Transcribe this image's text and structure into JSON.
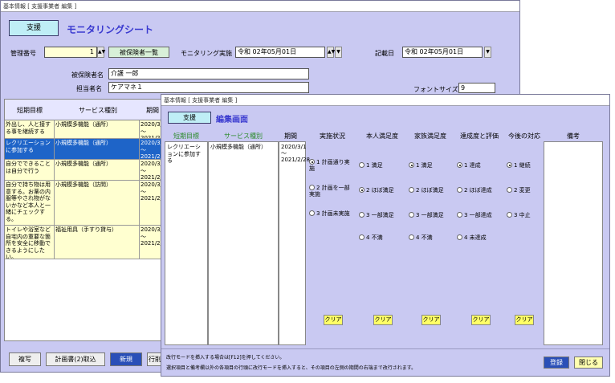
{
  "back": {
    "title_bar": "基本情報 [ 支援事業者 編集 ]",
    "header_btn": "支援",
    "header_title": "モニタリングシート",
    "mgmt_label": "管理番号",
    "mgmt_value": "1",
    "insured_list_btn": "被保険者一覧",
    "monitoring_label": "モニタリング実施",
    "monitoring_date": "令和 02年05月01日",
    "record_label": "記載日",
    "record_date": "令和 02年05月01日",
    "insured_label": "被保険者名",
    "insured_name": "介護 一郎",
    "manager_label": "担当者名",
    "manager_name": "ケアマネ１",
    "font_label": "フォントサイズ",
    "font_value": "9",
    "columns": [
      "短期目標",
      "サービス種別",
      "期間"
    ],
    "rows": [
      {
        "goal": "外出し、人と接する事を継続する",
        "service": "小規模多機能（通所）",
        "period": "2020/3/1 ～ 2021/2/28"
      },
      {
        "goal": "レクリエーションに参加する",
        "service": "小規模多機能（通所）",
        "period": "2020/3/1 ～ 2021/2/28"
      },
      {
        "goal": "自分でできることは自分で行う",
        "service": "小規模多機能（通所）",
        "period": "2020/3/1 ～ 2021/2/28"
      },
      {
        "goal": "自分で持ち物は用意する。お薬の内服等やされ物がないかなど本人と一緒にチェックする。",
        "service": "小規模多機能（訪問）",
        "period": "2020/3/1 ～ 2021/2/28"
      },
      {
        "goal": "トイレや浴室など自宅内の重要な箇所を安全に移動できるようにしたい。",
        "service": "福祉用具（手すり貸与）",
        "period": "2020/3/1 ～ 2021/2/28"
      }
    ],
    "bottom_buttons": [
      "複写",
      "計画書(2)取込",
      "新規",
      "行削"
    ]
  },
  "front": {
    "title_bar": "基本情報 [ 支援事業者 編集 ]",
    "header_btn": "支援",
    "header_title": "編集画面",
    "columns": [
      "短期目標",
      "サービス種別",
      "期間",
      "実施状況",
      "本人満足度",
      "家族満足度",
      "達成度と評価",
      "今後の対応",
      "備考"
    ],
    "goal": "レクリエーションに参加する",
    "service": "小規模多機能（通所）",
    "period_start": "2020/3/1",
    "period_sep": "～",
    "period_end": "2021/2/28",
    "implementation": [
      {
        "label": "1 計画通り実施",
        "selected": true
      },
      {
        "label": "2 計画を一部実施",
        "selected": false
      },
      {
        "label": "3 計画未実施",
        "selected": false
      }
    ],
    "self_satisfaction": [
      {
        "label": "1 満足",
        "selected": false
      },
      {
        "label": "2 ほぼ満足",
        "selected": true
      },
      {
        "label": "3 一部満足",
        "selected": false
      },
      {
        "label": "4 不満",
        "selected": false
      }
    ],
    "family_satisfaction": [
      {
        "label": "1 満足",
        "selected": true
      },
      {
        "label": "2 ほぼ満足",
        "selected": false
      },
      {
        "label": "3 一部満足",
        "selected": false
      },
      {
        "label": "4 不満",
        "selected": false
      }
    ],
    "achievement": [
      {
        "label": "1 達成",
        "selected": true
      },
      {
        "label": "2 ほぼ達成",
        "selected": false
      },
      {
        "label": "3 一部達成",
        "selected": false
      },
      {
        "label": "4 未達成",
        "selected": false
      }
    ],
    "future": [
      {
        "label": "1 継続",
        "selected": true
      },
      {
        "label": "2 変更",
        "selected": false
      },
      {
        "label": "3 中止",
        "selected": false
      }
    ],
    "clear_label": "クリア",
    "note1": "改行モードを挿入する場合は[F12]を押してください。",
    "note2": "選択項目と備考欄以外の各項目の行頭に改行モードを挿入すると、その項目の左側の期間の右端まで改行されます。",
    "save_btn": "登録",
    "close_btn": "閉じる"
  }
}
